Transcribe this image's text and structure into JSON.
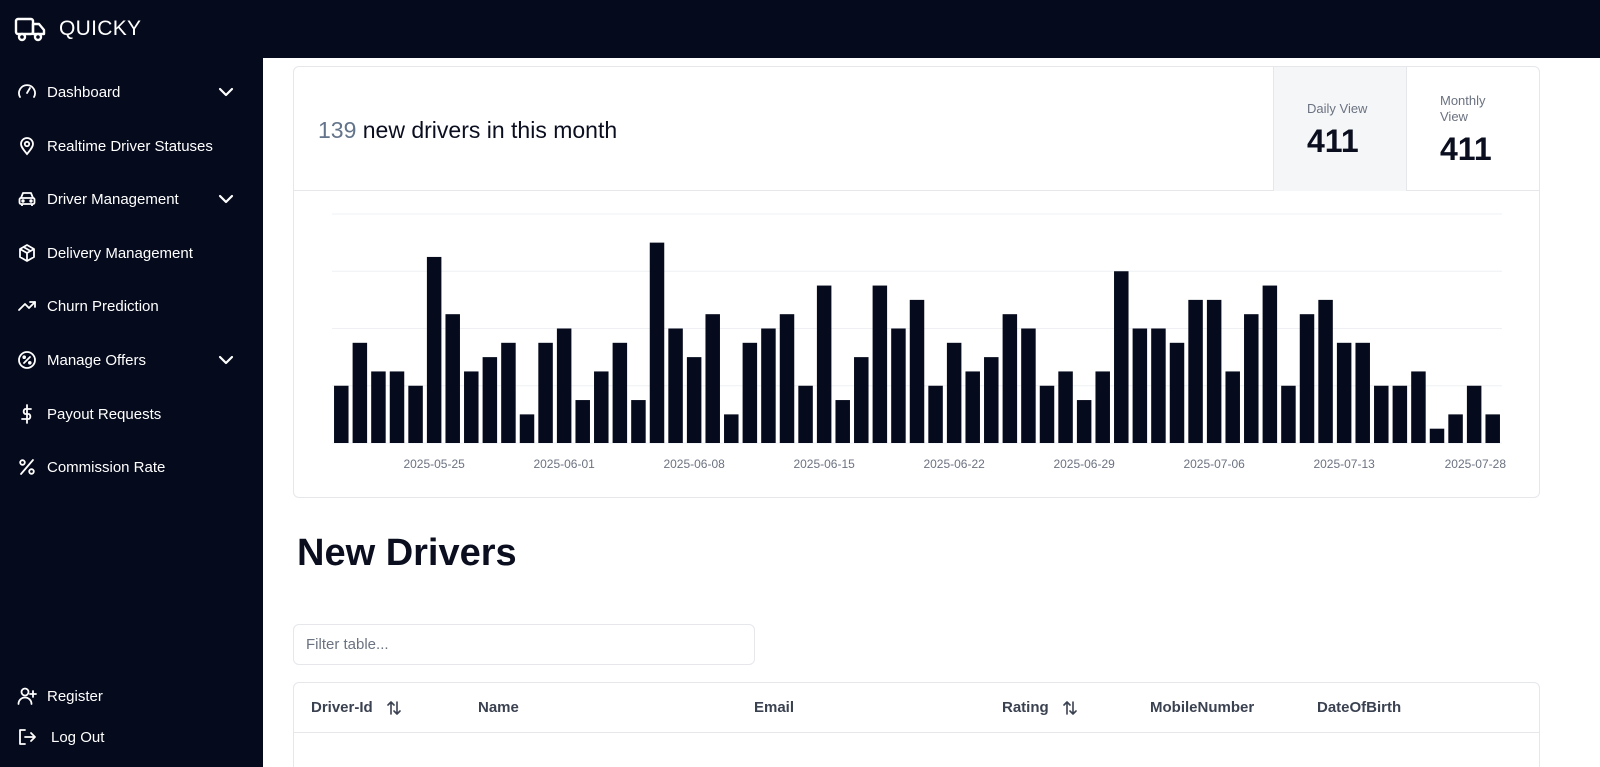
{
  "app": {
    "name": "QUICKY"
  },
  "sidebar": {
    "items": [
      {
        "label": "Dashboard",
        "icon": "gauge-icon",
        "has_chevron": true
      },
      {
        "label": "Realtime Driver Statuses",
        "icon": "map-pin-icon",
        "has_chevron": false
      },
      {
        "label": "Driver Management",
        "icon": "car-icon",
        "has_chevron": true
      },
      {
        "label": "Delivery Management",
        "icon": "package-icon",
        "has_chevron": false
      },
      {
        "label": "Churn Prediction",
        "icon": "trend-icon",
        "has_chevron": false
      },
      {
        "label": "Manage Offers",
        "icon": "badge-percent-icon",
        "has_chevron": true
      },
      {
        "label": "Payout Requests",
        "icon": "dollar-icon",
        "has_chevron": false
      },
      {
        "label": "Commission Rate",
        "icon": "percent-icon",
        "has_chevron": false
      }
    ],
    "footer": [
      {
        "label": "Register",
        "icon": "user-plus-icon"
      },
      {
        "label": "Log Out",
        "icon": "log-out-icon"
      }
    ]
  },
  "summary": {
    "count": "139",
    "text": "new drivers in this month"
  },
  "views": {
    "daily": {
      "label": "Daily View",
      "value": "411"
    },
    "monthly": {
      "label": "Monthly View",
      "value": "411"
    }
  },
  "chart_data": {
    "type": "bar",
    "bar_color": "#050a1c",
    "grid": true,
    "x_ticks": [
      "2025-05-25",
      "2025-06-01",
      "2025-06-08",
      "2025-06-15",
      "2025-06-22",
      "2025-06-29",
      "2025-07-06",
      "2025-07-13",
      "2025-07-28"
    ],
    "tick_bar_index": [
      5,
      12,
      19,
      26,
      33,
      40,
      47,
      54,
      61
    ],
    "values": [
      4,
      7,
      5,
      5,
      4,
      13,
      9,
      5,
      6,
      7,
      2,
      7,
      8,
      3,
      5,
      7,
      3,
      14,
      8,
      6,
      9,
      2,
      7,
      8,
      9,
      4,
      11,
      3,
      6,
      11,
      8,
      10,
      4,
      7,
      5,
      6,
      9,
      8,
      4,
      5,
      3,
      5,
      12,
      8,
      8,
      7,
      10,
      10,
      5,
      9,
      11,
      4,
      9,
      10,
      7,
      7,
      4,
      4,
      5,
      1,
      2,
      4,
      2
    ],
    "ylim": [
      0,
      16
    ]
  },
  "section": {
    "title": "New Drivers"
  },
  "filter": {
    "placeholder": "Filter table..."
  },
  "table": {
    "columns": [
      {
        "label": "Driver-Id",
        "sortable": true
      },
      {
        "label": "Name",
        "sortable": false
      },
      {
        "label": "Email",
        "sortable": false
      },
      {
        "label": "Rating",
        "sortable": true
      },
      {
        "label": "MobileNumber",
        "sortable": false
      },
      {
        "label": "DateOfBirth",
        "sortable": false
      }
    ]
  }
}
